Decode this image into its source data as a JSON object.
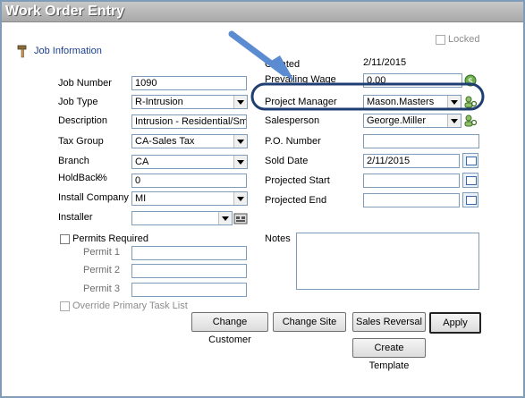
{
  "window": {
    "title": "Work Order Entry"
  },
  "header": {
    "section_label": "Job Information",
    "locked_label": "Locked"
  },
  "left": {
    "job_number_label": "Job Number",
    "job_number_value": "1090",
    "job_type_label": "Job Type",
    "job_type_value": "R-Intrusion",
    "description_label": "Description",
    "description_value": "Intrusion - Residential/Small Co",
    "tax_group_label": "Tax Group",
    "tax_group_value": "CA-Sales Tax",
    "branch_label": "Branch",
    "branch_value": "CA",
    "holdback_label": "HoldBack",
    "holdback_pct": "%",
    "holdback_value": "0",
    "install_company_label": "Install Company",
    "install_company_value": "MI",
    "installer_label": "Installer",
    "installer_value": "",
    "permits_required_label": "Permits Required",
    "permit1_label": "Permit 1",
    "permit2_label": "Permit 2",
    "permit3_label": "Permit 3",
    "override_label": "Override Primary Task List"
  },
  "right": {
    "created_label": "Created",
    "created_value": "2/11/2015",
    "prevailing_wage_label": "Prevailing Wage",
    "prevailing_wage_value": "0.00",
    "project_manager_label": "Project Manager",
    "project_manager_value": "Mason.Masters",
    "salesperson_label": "Salesperson",
    "salesperson_value": "George.Miller",
    "po_number_label": "P.O. Number",
    "po_number_value": "",
    "sold_date_label": "Sold Date",
    "sold_date_value": "2/11/2015",
    "projected_start_label": "Projected Start",
    "projected_end_label": "Projected End",
    "notes_label": "Notes"
  },
  "buttons": {
    "change_customer": "Change Customer",
    "change_site": "Change Site",
    "sales_reversal": "Sales Reversal",
    "apply": "Apply",
    "create_template": "Create Template"
  },
  "colors": {
    "highlight": "#1f3f73",
    "arrow": "#5b8bd1"
  }
}
